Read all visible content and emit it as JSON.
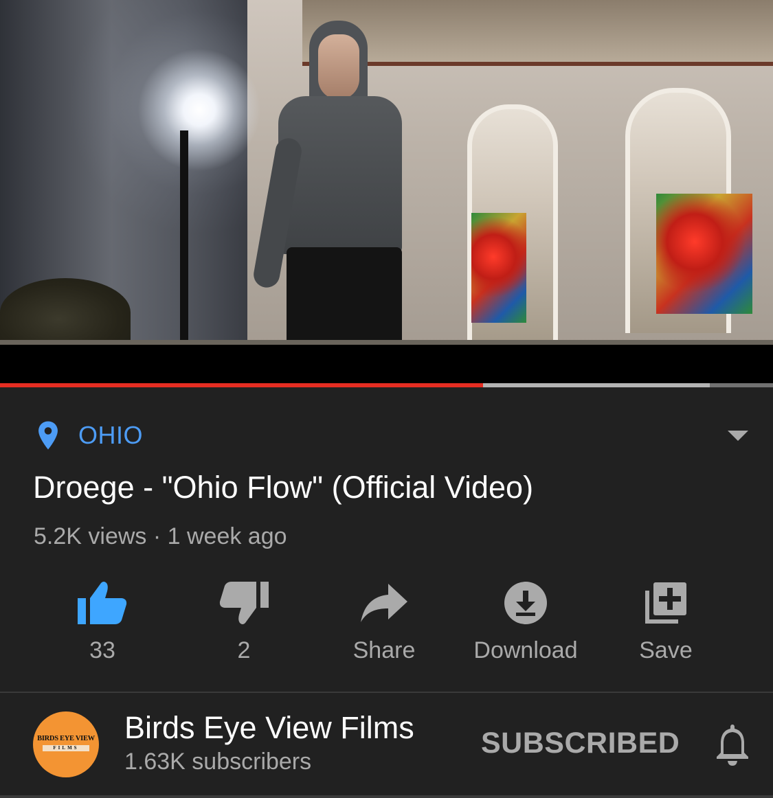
{
  "video": {
    "progress_played_fraction": 0.625,
    "progress_buffered_fraction": 0.918
  },
  "location": {
    "icon": "location-pin-icon",
    "label": "OHIO",
    "color": "#4d9cf5"
  },
  "title": "Droege - \"Ohio Flow\" (Official Video)",
  "meta": "5.2K views · 1 week ago",
  "actions": {
    "like": {
      "icon": "thumbs-up-icon",
      "label": "33",
      "color": "#3ea6ff"
    },
    "dislike": {
      "icon": "thumbs-down-icon",
      "label": "2"
    },
    "share": {
      "icon": "share-icon",
      "label": "Share"
    },
    "download": {
      "icon": "download-icon",
      "label": "Download"
    },
    "save": {
      "icon": "add-to-playlist-icon",
      "label": "Save"
    }
  },
  "channel": {
    "avatar_text_top": "BIRDS EYE VIEW",
    "avatar_text_bottom": "FILMS",
    "name": "Birds Eye View Films",
    "subscribers": "1.63K subscribers",
    "subscribe_label": "SUBSCRIBED",
    "bell_icon": "bell-icon"
  },
  "colors": {
    "background": "#212121",
    "progress_played": "#e52d22",
    "secondary_text": "#aaaaaa"
  }
}
